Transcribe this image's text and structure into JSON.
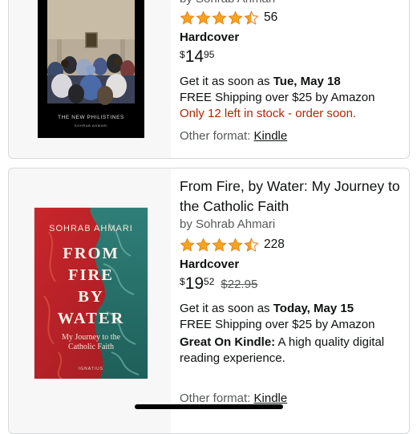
{
  "results": [
    {
      "title": "",
      "author": "by Sohrab Ahmari",
      "rating": 4.5,
      "rating_count": "56",
      "format": "Hardcover",
      "price": {
        "symbol": "$",
        "whole": "14",
        "fraction": "95",
        "list_price": ""
      },
      "delivery_prefix": "Get it as soon as ",
      "delivery_date": "Tue, May 18",
      "shipping": "FREE Shipping over $25 by Amazon",
      "stock": "Only 12 left in stock - order soon.",
      "other_format_label": "Other format: ",
      "other_format_link": "Kindle",
      "cover": {
        "title": "THE NEW PHILISTINES",
        "author": "SOHRAB AHMARI"
      }
    },
    {
      "title": "From Fire, by Water: My Journey to the Catholic Faith",
      "author": "by Sohrab Ahmari",
      "rating": 4.5,
      "rating_count": "228",
      "format": "Hardcover",
      "price": {
        "symbol": "$",
        "whole": "19",
        "fraction": "52",
        "list_price": "$22.95"
      },
      "delivery_prefix": "Get it as soon as ",
      "delivery_date": "Today, May 15",
      "shipping": "FREE Shipping over $25 by Amazon",
      "kindle_heading": "Great On Kindle:",
      "kindle_text": " A high quality digital reading experience.",
      "other_format_label": "Other format: ",
      "other_format_link": "Kindle",
      "cover": {
        "author": "SOHRAB AHMARI",
        "title_lines": [
          "FROM",
          "FIRE",
          "BY",
          "WATER"
        ],
        "subtitle": "My Journey to the Catholic Faith",
        "publisher": "IGNATIUS"
      }
    }
  ],
  "colors": {
    "star": "#f4a41d",
    "urgent": "#b12704",
    "muted": "#565959",
    "border": "#d5d9d9"
  }
}
